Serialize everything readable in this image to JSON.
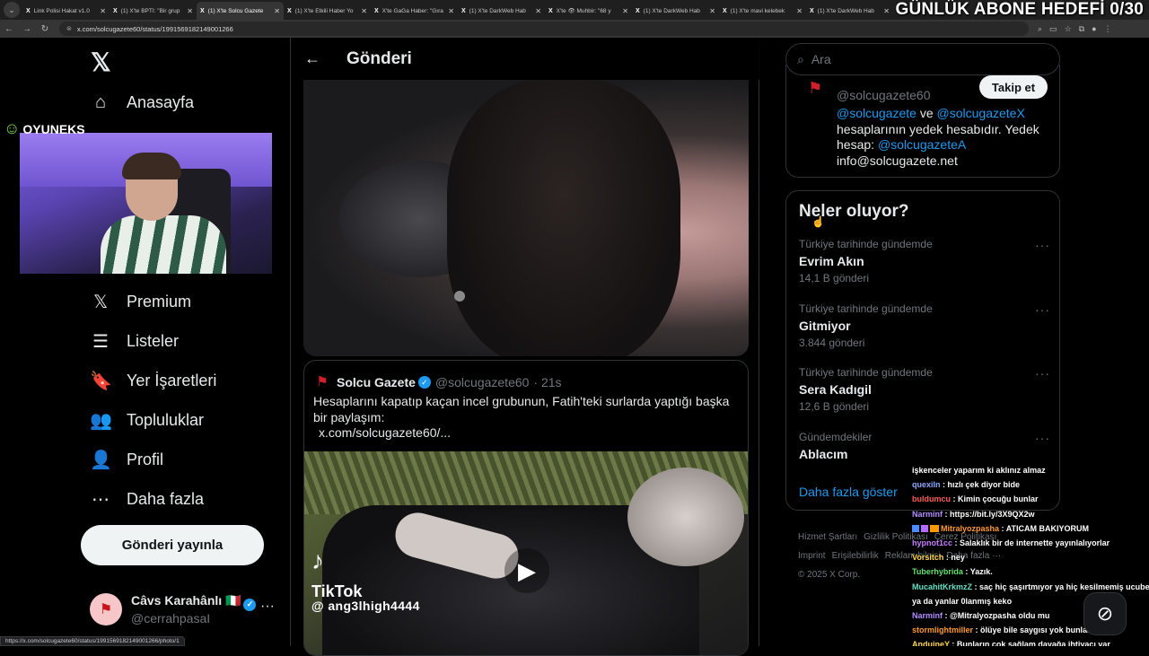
{
  "browser": {
    "tabs": [
      {
        "title": "Link Polisi Hakat v1.0",
        "icon": "X"
      },
      {
        "title": "(1) X'te BPTİ: \"Bir grup",
        "icon": "X"
      },
      {
        "title": "(1) X'te Solcu Gazete",
        "icon": "X",
        "active": true
      },
      {
        "title": "(1) X'te Etkili Haber Yo",
        "icon": "X"
      },
      {
        "title": "X'te GaGa Haber: \"Gıra",
        "icon": "X"
      },
      {
        "title": "(1) X'te DarkWeb Hab",
        "icon": "X"
      },
      {
        "title": "X'te 👁 Muhbir: \"68 y",
        "icon": "X"
      },
      {
        "title": "(1) X'te DarkWeb Hab",
        "icon": "X"
      },
      {
        "title": "(1) X'te mavi kelebek",
        "icon": "X"
      },
      {
        "title": "(1) X'te DarkWeb Hab",
        "icon": "X"
      }
    ],
    "url": "x.com/solcugazete60/status/1991569182149001266",
    "status_url": "https://x.com/solcugazete60/status/1991569182149001266/photo/1"
  },
  "overlay": {
    "goal": "GÜNLÜK ABONE HEDEFİ 0/30",
    "webcam_logo": "OYUNEKS"
  },
  "nav": {
    "logo": "𝕏",
    "items": [
      {
        "label": "Anasayfa",
        "icon": "⌂"
      },
      {
        "label": "Premium",
        "icon": "𝕏"
      },
      {
        "label": "Listeler",
        "icon": "☰"
      },
      {
        "label": "Yer İşaretleri",
        "icon": "🔖"
      },
      {
        "label": "Topluluklar",
        "icon": "👥"
      },
      {
        "label": "Profil",
        "icon": "👤"
      },
      {
        "label": "Daha fazla",
        "icon": "⋯"
      }
    ],
    "post_button": "Gönderi yayınla",
    "profile": {
      "name": "Câvs Karahânlı 🇮🇹",
      "handle": "@cerrahpasaI",
      "more": "···"
    }
  },
  "post": {
    "header_title": "Gönderi",
    "back": "←",
    "quote": {
      "name": "Solcu Gazete",
      "handle": "@solcugazete60",
      "time": "· 21s",
      "text": "Hesaplarını kapatıp kaçan incel grubunun, Fatih'teki surlarda yaptığı başka bir paylaşım:",
      "link": "x.com/solcugazete60/...",
      "video": {
        "tiktok": "TikTok",
        "tiktok_handle": "@ ang3lhigh4444",
        "play": "▶"
      }
    }
  },
  "right": {
    "search_placeholder": "Ara",
    "account": {
      "handle": "@solcugazete60",
      "follow": "Takip et",
      "bio_link1": "@solcugazete",
      "bio_mid": " ve ",
      "bio_link2": "@solcugazeteX",
      "bio_text": " hesaplarının yedek hesabıdır. Yedek hesap: ",
      "bio_link3": "@solcugazeteA",
      "bio_email": "info@solcugazete.net"
    },
    "trends_title": "Neler oluyor?",
    "trends": [
      {
        "category": "Türkiye tarihinde gündemde",
        "name": "Evrim Akın",
        "posts": "14,1 B gönderi"
      },
      {
        "category": "Türkiye tarihinde gündemde",
        "name": "Gitmiyor",
        "posts": "3.844 gönderi"
      },
      {
        "category": "Türkiye tarihinde gündemde",
        "name": "Sera Kadıgil",
        "posts": "12,6 B gönderi"
      },
      {
        "category": "Gündemdekiler",
        "name": "Ablacım",
        "posts": ""
      }
    ],
    "show_more": "Daha fazla göster",
    "footer": [
      "Hizmet Şartları",
      "Gizlilik Politikası",
      "Çerez Politikası",
      "Imprint",
      "Erişilebilirlik",
      "Reklam bilgisi",
      "Daha fazla ···",
      "© 2025 X Corp."
    ]
  },
  "chat": [
    {
      "user": "",
      "color": "#ffffff",
      "msg": "işkenceler yaparım ki aklınız almaz"
    },
    {
      "user": "quexiln",
      "color": "#8aa8ff",
      "msg": ": hızlı çek diyor bide"
    },
    {
      "user": "buldumcu",
      "color": "#ff5a5a",
      "msg": ": Kimin çocuğu bunlar"
    },
    {
      "user": "Narminf",
      "color": "#b48cff",
      "msg": ": https://bit.ly/3X9QX2w"
    },
    {
      "user": "Mitralyozpasha",
      "color": "#ff9a2e",
      "msg": ": ATICAM BAKIYORUM",
      "badges": true
    },
    {
      "user": "hypnot1cc",
      "color": "#c77dff",
      "msg": ": Salaklık bir de internette yayınlalıyorlar"
    },
    {
      "user": "Vorsitch",
      "color": "#ffd84d",
      "msg": ": ney"
    },
    {
      "user": "Tuberhybrida",
      "color": "#62e06b",
      "msg": ": Yazık."
    },
    {
      "user": "MucahitKrkmzZ",
      "color": "#62e0c6",
      "msg": ": saç hiç şaşırtmıyor ya hiç kesilmemiş ucube"
    },
    {
      "user": "",
      "color": "#ffffff",
      "msg": "ya da yanlar 0lanmış keko"
    },
    {
      "user": "Narminf",
      "color": "#b48cff",
      "msg": ": @Mitralyozpasha oldu mu"
    },
    {
      "user": "stormlightmiller",
      "color": "#ff9a2e",
      "msg": ": ölüye bile saygısı yok bunların"
    },
    {
      "user": "AnduineY",
      "color": "#ffd84d",
      "msg": ": Bunların çok sağlam dayağa ihtiyacı var"
    }
  ]
}
